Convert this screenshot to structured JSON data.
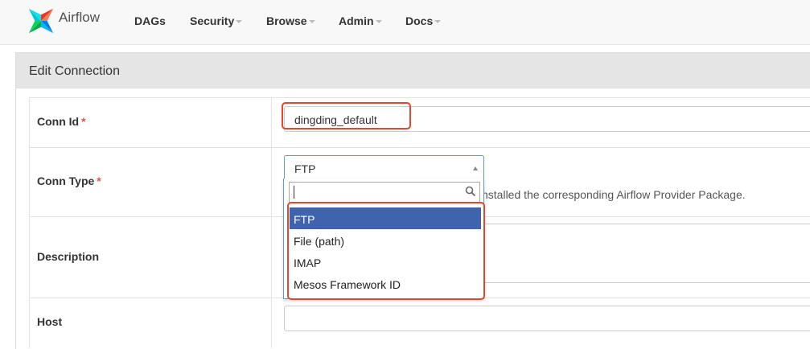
{
  "nav": {
    "brand": "Airflow",
    "items": [
      {
        "label": "DAGs",
        "dropdown": false
      },
      {
        "label": "Security",
        "dropdown": true
      },
      {
        "label": "Browse",
        "dropdown": true
      },
      {
        "label": "Admin",
        "dropdown": true
      },
      {
        "label": "Docs",
        "dropdown": true
      }
    ]
  },
  "panel": {
    "title": "Edit Connection"
  },
  "form": {
    "conn_id": {
      "label": "Conn Id",
      "required_mark": "*",
      "value": "dingding_default"
    },
    "conn_type": {
      "label": "Conn Type",
      "required_mark": "*",
      "selected": "FTP",
      "help_text_visible": "nstalled the corresponding Airflow Provider Package.",
      "dropdown": {
        "search_value": "",
        "options": [
          "FTP",
          "File (path)",
          "IMAP",
          "Mesos Framework ID"
        ],
        "active_option": "FTP"
      }
    },
    "description": {
      "label": "Description",
      "value": ""
    },
    "host": {
      "label": "Host",
      "value": ""
    }
  },
  "icons": {
    "search": "search-icon",
    "select_arrow": "caret-up-icon",
    "logo": "airflow-pinwheel-logo"
  },
  "colors": {
    "highlight": "#e8452c",
    "active_option": "#3f63ad",
    "required": "#d9534f",
    "focus_border": "#5b9bd5"
  }
}
